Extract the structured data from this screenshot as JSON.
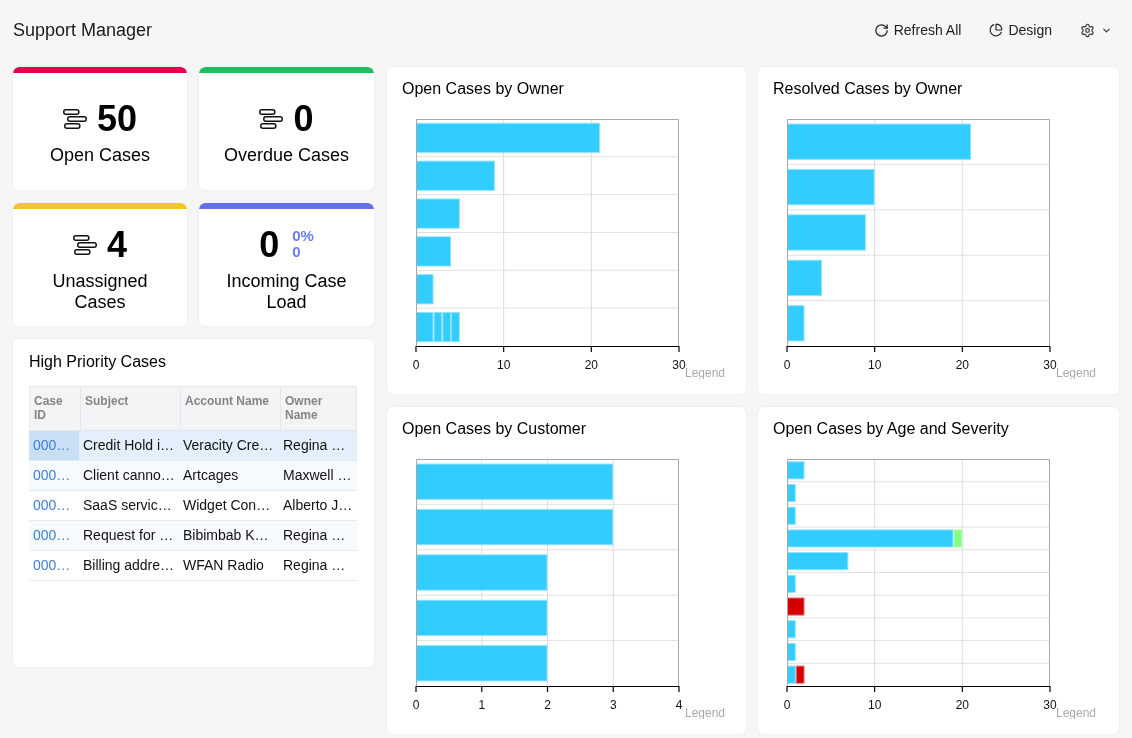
{
  "header": {
    "title": "Support Manager",
    "actions": [
      {
        "kind": "refresh",
        "label": "Refresh All"
      },
      {
        "kind": "design",
        "label": "Design"
      }
    ]
  },
  "kpis": [
    {
      "kind": "count",
      "value": "50",
      "label": "Open Cases",
      "color": "#e8004d"
    },
    {
      "kind": "count",
      "value": "0",
      "label": "Overdue Cases",
      "color": "#1fbf5f"
    },
    {
      "kind": "count",
      "value": "4",
      "label": "Unassigned Cases",
      "color": "#f0c823"
    },
    {
      "kind": "trend",
      "value": "0",
      "label": "Incoming Case Load",
      "color": "#6272e6",
      "change": "0%",
      "delta": "0"
    }
  ],
  "table": {
    "title": "High Priority Cases",
    "columns": [
      "Case ID",
      "Subject",
      "Account Name",
      "Owner Name"
    ],
    "rows": [
      {
        "selected": true,
        "cells": [
          "000…",
          "Credit Hold i…",
          "Veracity Cre…",
          "Regina …"
        ]
      },
      {
        "selected": false,
        "cells": [
          "000…",
          "Client canno…",
          "Artcages",
          "Maxwell …"
        ]
      },
      {
        "selected": false,
        "cells": [
          "000…",
          "SaaS servic…",
          "Widget Con…",
          "Alberto J…"
        ]
      },
      {
        "selected": false,
        "cells": [
          "000…",
          "Request for …",
          "Bibimbab K…",
          "Regina …"
        ]
      },
      {
        "selected": false,
        "cells": [
          "000…",
          "Billing addre…",
          "WFAN Radio",
          "Regina …"
        ]
      }
    ]
  },
  "charts": [
    {
      "title": "Open Cases by Owner",
      "legend": "Legend",
      "chart_data": {
        "type": "bar",
        "orientation": "horizontal",
        "stacked": true,
        "grid": true,
        "xlim": [
          0,
          30
        ],
        "xticks": [
          0,
          10,
          20,
          30
        ],
        "series": [
          {
            "color": "#33ccff",
            "values": [
              21,
              9,
              5,
              4,
              2,
              2
            ]
          },
          {
            "color": "#33ccff",
            "values": [
              0,
              0,
              0,
              0,
              0,
              1
            ]
          },
          {
            "color": "#33ccff",
            "values": [
              0,
              0,
              0,
              0,
              0,
              1
            ]
          },
          {
            "color": "#33ccff",
            "values": [
              0,
              0,
              0,
              0,
              0,
              1
            ]
          }
        ]
      }
    },
    {
      "title": "Resolved Cases by Owner",
      "legend": "Legend",
      "chart_data": {
        "type": "bar",
        "orientation": "horizontal",
        "grid": true,
        "xlim": [
          0,
          30
        ],
        "xticks": [
          0,
          10,
          20,
          30
        ],
        "series": [
          {
            "color": "#33ccff",
            "values": [
              21,
              10,
              9,
              4,
              2
            ]
          }
        ]
      }
    },
    {
      "title": "Open Cases by Customer",
      "legend": "Legend",
      "chart_data": {
        "type": "bar",
        "orientation": "horizontal",
        "grid": true,
        "xlim": [
          0,
          4
        ],
        "xticks": [
          0,
          1,
          2,
          3,
          4
        ],
        "series": [
          {
            "color": "#33ccff",
            "values": [
              3,
              3,
              2,
              2,
              2
            ]
          }
        ]
      }
    },
    {
      "title": "Open Cases by Age and Severity",
      "legend": "Legend",
      "chart_data": {
        "type": "bar",
        "orientation": "horizontal",
        "stacked": true,
        "grid": true,
        "xlim": [
          0,
          30
        ],
        "xticks": [
          0,
          10,
          20,
          30
        ],
        "series": [
          {
            "color": "#33ccff",
            "values": [
              2,
              1,
              1,
              19,
              7,
              1,
              0,
              1,
              1,
              1
            ]
          },
          {
            "color": "#80ff80",
            "values": [
              0,
              0,
              0,
              1,
              0,
              0,
              0,
              0,
              0,
              0
            ]
          },
          {
            "color": "#d40000",
            "values": [
              0,
              0,
              0,
              0,
              0,
              0,
              2,
              0,
              0,
              1
            ]
          }
        ]
      }
    }
  ]
}
